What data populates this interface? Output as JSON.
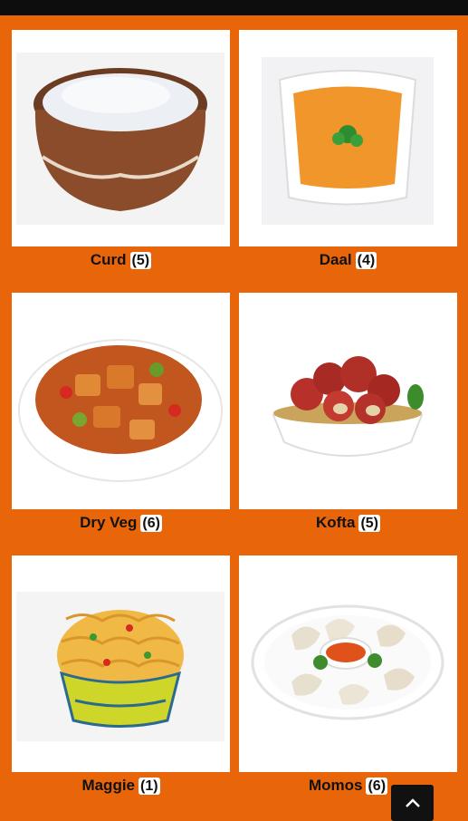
{
  "colors": {
    "background": "#e8650a",
    "card": "#ffffff",
    "statusbar": "#0d0d0d"
  },
  "items": [
    {
      "name": "Curd",
      "count": "(5)",
      "icon": "curd-pot-image"
    },
    {
      "name": "Daal",
      "count": "(4)",
      "icon": "daal-bowl-image"
    },
    {
      "name": "Dry Veg",
      "count": "(6)",
      "icon": "dry-veg-plate-image"
    },
    {
      "name": "Kofta",
      "count": "(5)",
      "icon": "kofta-bowl-image"
    },
    {
      "name": "Maggie",
      "count": "(1)",
      "icon": "maggie-noodles-image"
    },
    {
      "name": "Momos",
      "count": "(6)",
      "icon": "momos-plate-image"
    }
  ],
  "scroll_top": {
    "icon": "chevron-up-icon"
  }
}
